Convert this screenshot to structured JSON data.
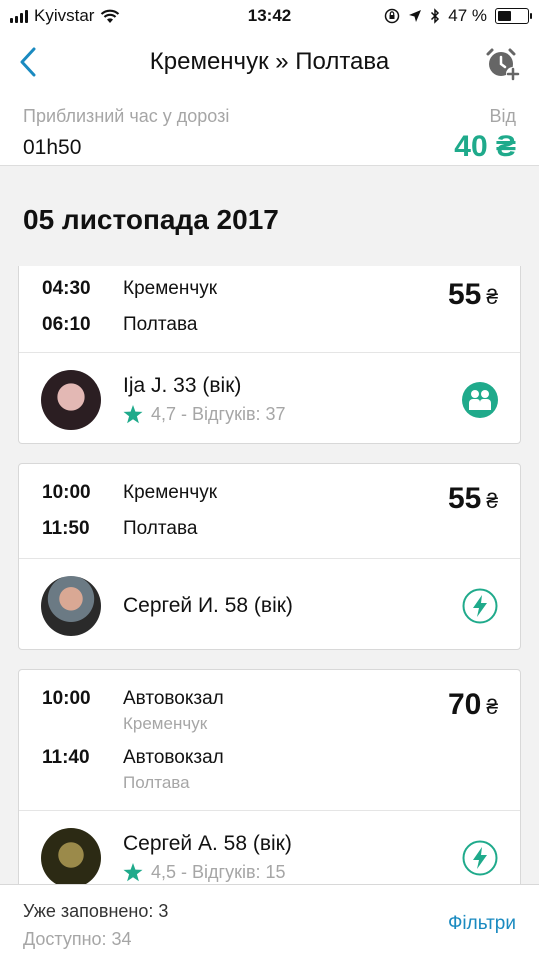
{
  "status_bar": {
    "carrier": "Kyivstar",
    "time": "13:42",
    "battery": "47 %",
    "battery_level": 0.47
  },
  "header": {
    "title": "Кременчук » Полтава"
  },
  "summary": {
    "travel_time_label": "Приблизний час у дорозі",
    "travel_time_value": "01h50",
    "price_from_label": "Від",
    "price_from_value": "40",
    "currency": "₴"
  },
  "date": "05 листопада 2017",
  "trips": [
    {
      "depart_time": "04:30",
      "depart_place": "Кременчук",
      "depart_sub": "",
      "arrive_time": "06:10",
      "arrive_place": "Полтава",
      "arrive_sub": "",
      "price": "55",
      "currency": "₴",
      "driver": "Ija J. 33 (вік)",
      "rating": "4,7 - Відгуків: 37",
      "badge": "group-icon"
    },
    {
      "depart_time": "10:00",
      "depart_place": "Кременчук",
      "depart_sub": "",
      "arrive_time": "11:50",
      "arrive_place": "Полтава",
      "arrive_sub": "",
      "price": "55",
      "currency": "₴",
      "driver": "Сергей И. 58 (вік)",
      "rating": "",
      "badge": "lightning-icon"
    },
    {
      "depart_time": "10:00",
      "depart_place": "Автовокзал",
      "depart_sub": "Кременчук",
      "arrive_time": "11:40",
      "arrive_place": "Автовокзал",
      "arrive_sub": "Полтава",
      "price": "70",
      "currency": "₴",
      "driver": "Сергей А. 58 (вік)",
      "rating": "4,5 - Відгуків: 15",
      "badge": "lightning-icon"
    }
  ],
  "footer": {
    "filled": "Уже заповнено: 3",
    "available": "Доступно: 34",
    "filters": "Фільтри"
  },
  "colors": {
    "accent_green": "#1faa8b",
    "link_blue": "#1a8ac0"
  }
}
